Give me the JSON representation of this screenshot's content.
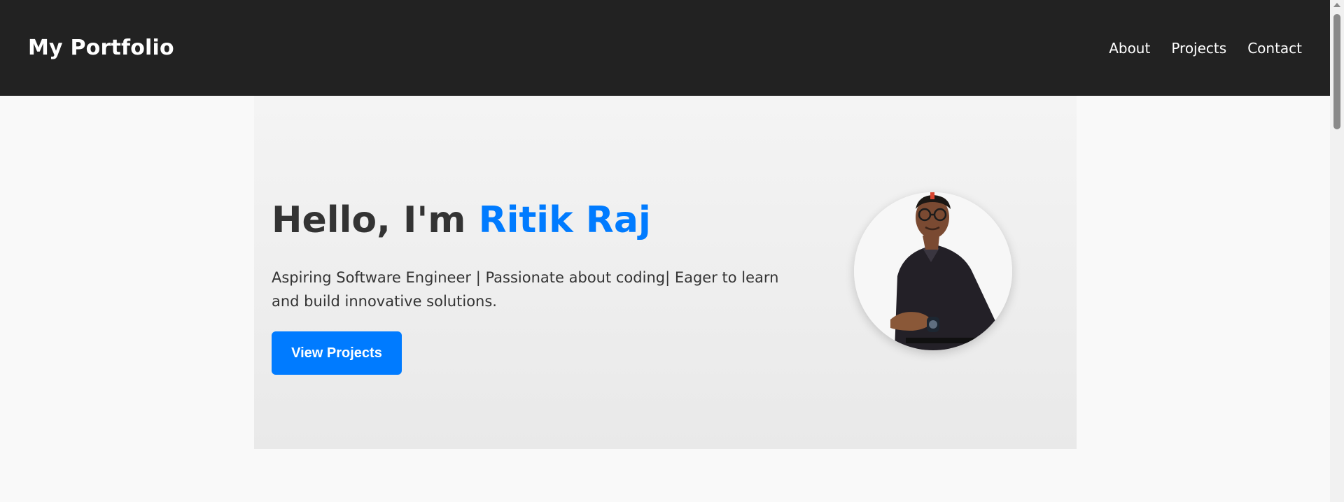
{
  "header": {
    "brand": "My Portfolio",
    "nav": [
      {
        "label": "About"
      },
      {
        "label": "Projects"
      },
      {
        "label": "Contact"
      }
    ]
  },
  "hero": {
    "title_prefix": "Hello, I'm ",
    "title_name": "Ritik Raj",
    "subtitle": "Aspiring Software Engineer | Passionate about coding| Eager to learn and build innovative solutions.",
    "cta_label": "View Projects",
    "avatar_icon": "person-photo"
  },
  "colors": {
    "accent": "#007bff",
    "navbar": "#222222",
    "text": "#333333",
    "background": "#f9f9f9"
  }
}
